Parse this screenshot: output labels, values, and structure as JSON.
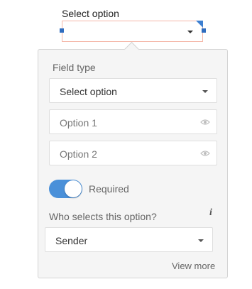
{
  "field": {
    "label": "Select option"
  },
  "popover": {
    "field_type_label": "Field type",
    "field_type_value": "Select option",
    "options": [
      {
        "placeholder": "Option 1"
      },
      {
        "placeholder": "Option 2"
      }
    ],
    "required_label": "Required",
    "required_on": true,
    "who_selects_label": "Who selects this option?",
    "who_selects_value": "Sender",
    "info_icon_glyph": "i",
    "view_more_label": "View more"
  },
  "colors": {
    "accent": "#4a90d9",
    "field_border": "#f4b7a8",
    "handle": "#2f6dbf"
  },
  "icons": [
    "caret-down-icon",
    "eye-icon",
    "info-icon"
  ]
}
